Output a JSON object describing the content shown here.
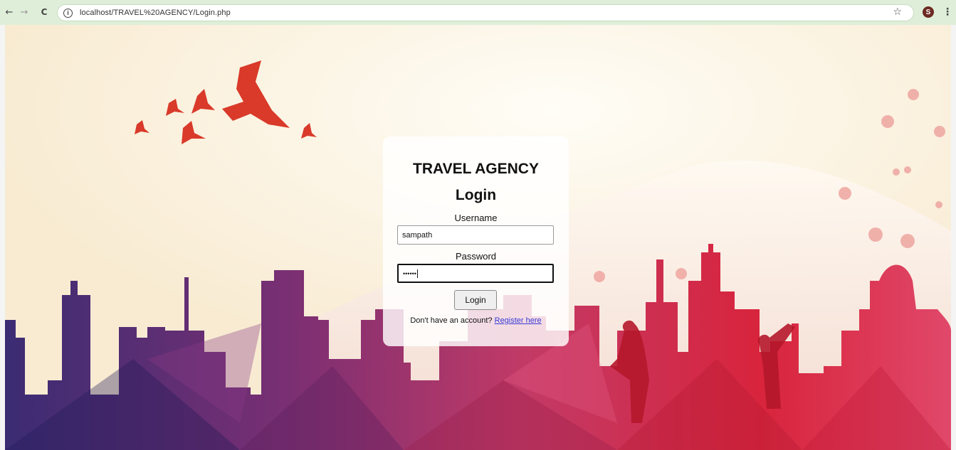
{
  "browser": {
    "back_icon": "←",
    "forward_icon": "→",
    "reload_icon": "C",
    "info_icon": "i",
    "url": "localhost/TRAVEL%20AGENCY/Login.php",
    "star_icon": "☆",
    "avatar_initial": "S",
    "menu_icon": "⋮"
  },
  "login": {
    "brand": "TRAVEL AGENCY",
    "title": "Login",
    "username_label": "Username",
    "username_value": "sampath",
    "password_label": "Password",
    "password_value": "••••••",
    "button_label": "Login",
    "footer_text": "Don't have an account?",
    "register_link": "Register here"
  },
  "colors": {
    "chrome": "#dfeed9",
    "link": "#3a3ad6",
    "sky": "#fbf1dc",
    "skyline_left": "#3a2a6b",
    "skyline_right": "#d22a4a"
  }
}
